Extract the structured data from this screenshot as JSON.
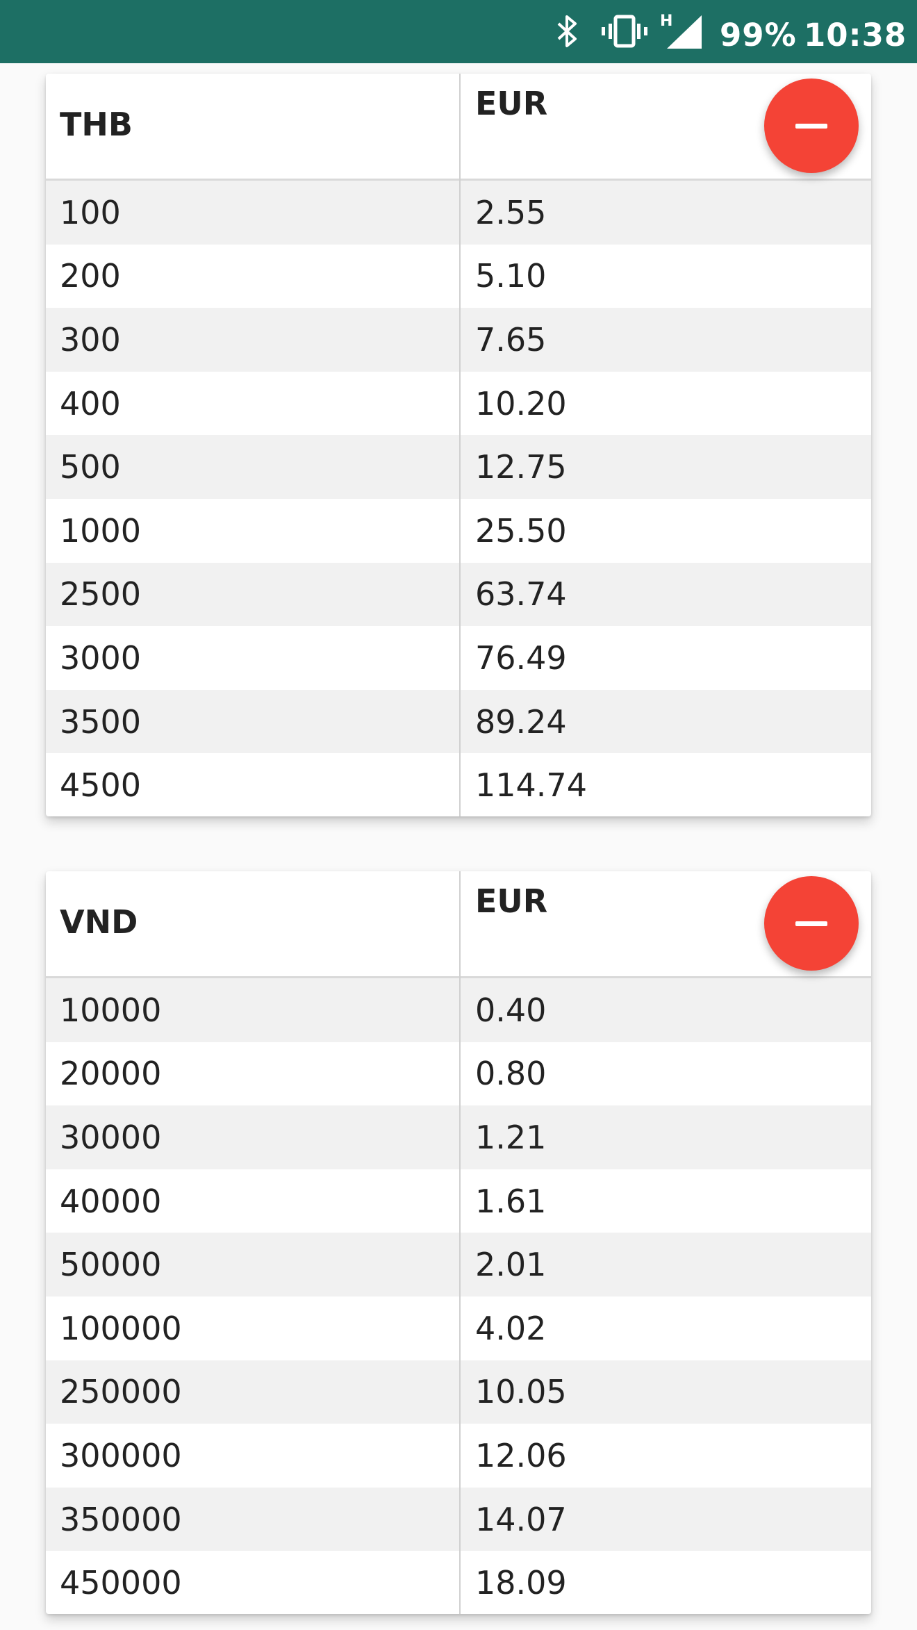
{
  "status_bar": {
    "battery": "99%",
    "time": "10:38",
    "network_type": "H",
    "icons": [
      "bluetooth-icon",
      "vibrate-icon",
      "signal-icon"
    ],
    "color": "#1d6f64"
  },
  "tables": [
    {
      "from_currency": "THB",
      "to_currency": "EUR",
      "remove_button_color": "#f44336",
      "rows": [
        {
          "from": "100",
          "to": "2.55"
        },
        {
          "from": "200",
          "to": "5.10"
        },
        {
          "from": "300",
          "to": "7.65"
        },
        {
          "from": "400",
          "to": "10.20"
        },
        {
          "from": "500",
          "to": "12.75"
        },
        {
          "from": "1000",
          "to": "25.50"
        },
        {
          "from": "2500",
          "to": "63.74"
        },
        {
          "from": "3000",
          "to": "76.49"
        },
        {
          "from": "3500",
          "to": "89.24"
        },
        {
          "from": "4500",
          "to": "114.74"
        }
      ]
    },
    {
      "from_currency": "VND",
      "to_currency": "EUR",
      "remove_button_color": "#f44336",
      "rows": [
        {
          "from": "10000",
          "to": "0.40"
        },
        {
          "from": "20000",
          "to": "0.80"
        },
        {
          "from": "30000",
          "to": "1.21"
        },
        {
          "from": "40000",
          "to": "1.61"
        },
        {
          "from": "50000",
          "to": "2.01"
        },
        {
          "from": "100000",
          "to": "4.02"
        },
        {
          "from": "250000",
          "to": "10.05"
        },
        {
          "from": "300000",
          "to": "12.06"
        },
        {
          "from": "350000",
          "to": "14.07"
        },
        {
          "from": "450000",
          "to": "18.09"
        }
      ]
    }
  ]
}
